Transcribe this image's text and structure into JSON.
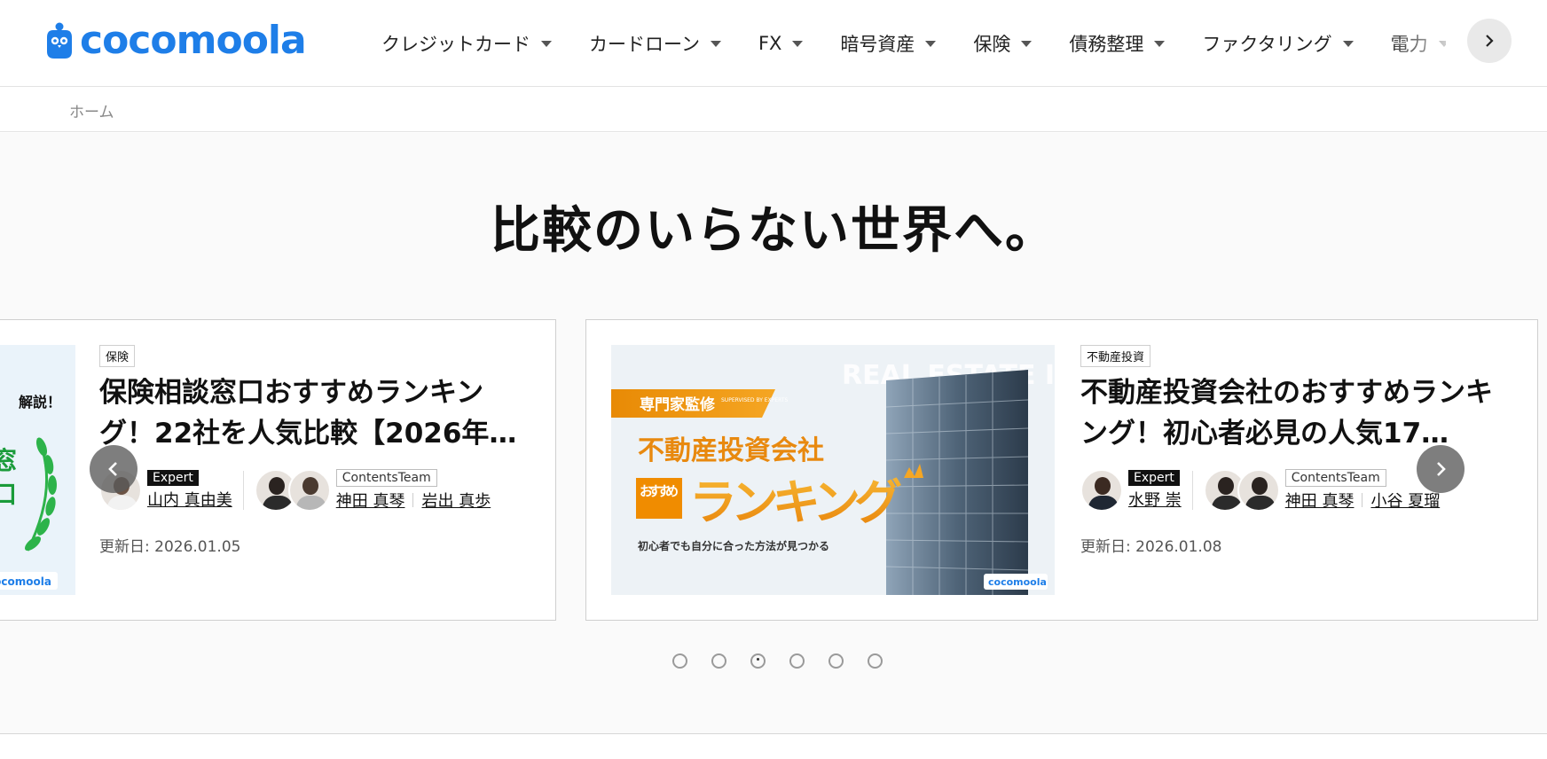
{
  "header": {
    "logo_text": "cocomoola",
    "nav": [
      {
        "label": "クレジットカード"
      },
      {
        "label": "カードローン"
      },
      {
        "label": "FX"
      },
      {
        "label": "暗号資産"
      },
      {
        "label": "保険"
      },
      {
        "label": "債務整理"
      },
      {
        "label": "ファクタリング"
      },
      {
        "label": "電力"
      }
    ],
    "accent_color": "#1e7ee8"
  },
  "breadcrumb": {
    "home": "ホーム"
  },
  "hero": {
    "tagline": "比較のいらない世界へ。"
  },
  "cards": [
    {
      "category": "保険",
      "title": "保険相談窓口おすすめランキング！22社を人気比較【2026年…",
      "thumb_text_1": "解説！",
      "thumb_text_2": "窓",
      "thumb_text_3": "口",
      "thumb_logo": "cocomoola",
      "expert_badge": "Expert",
      "expert_name": "山内 真由美",
      "team_badge": "ContentsTeam",
      "team_names": [
        "神田 真琴",
        "岩出 真歩"
      ],
      "date": "更新日: 2026.01.05"
    },
    {
      "category": "不動産投資",
      "title": "不動産投資会社のおすすめランキング！初心者必見の人気17…",
      "thumb_ribbon": "専門家監修",
      "thumb_ribbon_sub": "SUPERVISED BY EXPERTS",
      "thumb_heading": "不動産投資会社",
      "thumb_osusume": "おすすめ",
      "thumb_ranking": "ランキング",
      "thumb_caption": "初心者でも自分に合った方法が見つかる",
      "thumb_bg_text": "REAL ESTATE INVESTMENT",
      "thumb_logo": "cocomoola",
      "expert_badge": "Expert",
      "expert_name": "水野 崇",
      "team_badge": "ContentsTeam",
      "team_names": [
        "神田 真琴",
        "小谷 夏瑠"
      ],
      "date": "更新日: 2026.01.08"
    }
  ],
  "carousel": {
    "total_slides": 6,
    "active_index": 2
  },
  "icons": {
    "nav_next": "chevron-right-icon",
    "carousel_prev": "chevron-left-icon",
    "carousel_next": "chevron-right-icon"
  }
}
